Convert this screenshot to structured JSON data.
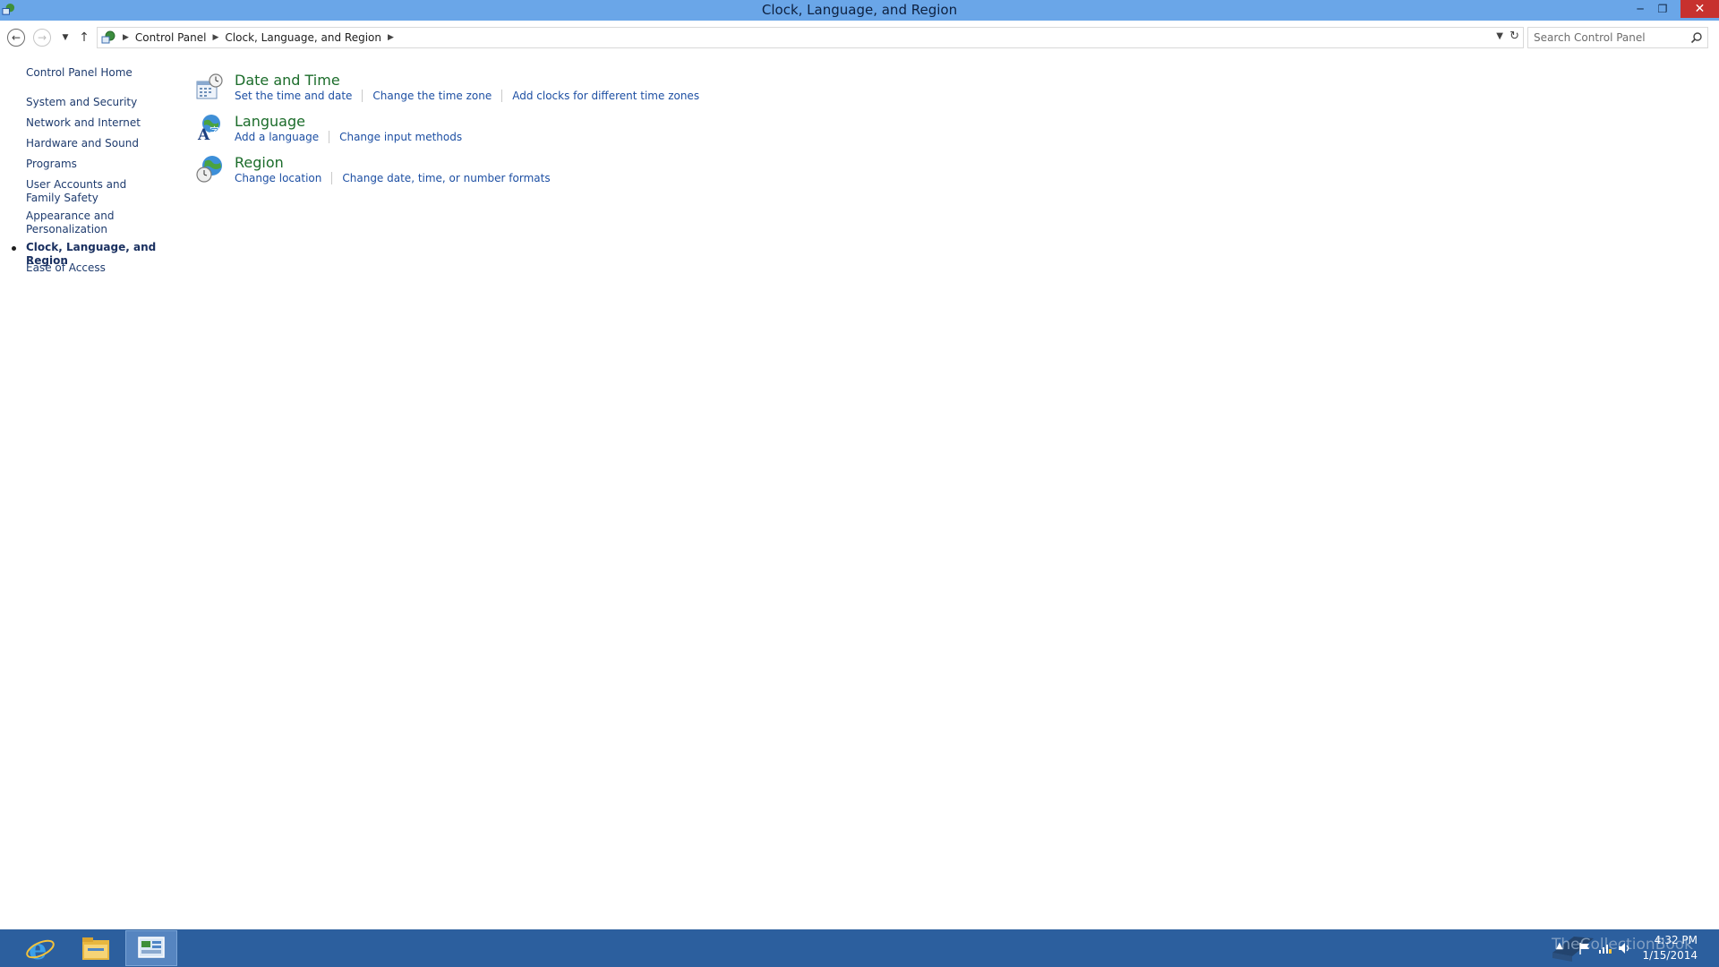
{
  "window": {
    "title": "Clock, Language, and Region",
    "controls": {
      "minimize": "─",
      "maximize": "❐",
      "close": "✕"
    }
  },
  "navbar": {
    "breadcrumbs": [
      "Control Panel",
      "Clock, Language, and Region"
    ],
    "search_placeholder": "Search Control Panel"
  },
  "sidebar": {
    "items": [
      {
        "label": "Control Panel Home"
      },
      {
        "label": "System and Security"
      },
      {
        "label": "Network and Internet"
      },
      {
        "label": "Hardware and Sound"
      },
      {
        "label": "Programs"
      },
      {
        "label": "User Accounts and Family Safety"
      },
      {
        "label": "Appearance and Personalization"
      },
      {
        "label": "Clock, Language, and Region",
        "current": true
      },
      {
        "label": "Ease of Access"
      }
    ]
  },
  "categories": [
    {
      "title": "Date and Time",
      "icon": "date-time-icon",
      "tasks": [
        "Set the time and date",
        "Change the time zone",
        "Add clocks for different time zones"
      ]
    },
    {
      "title": "Language",
      "icon": "language-icon",
      "tasks": [
        "Add a language",
        "Change input methods"
      ]
    },
    {
      "title": "Region",
      "icon": "region-icon",
      "tasks": [
        "Change location",
        "Change date, time, or number formats"
      ]
    }
  ],
  "taskbar": {
    "pinned": [
      "internet-explorer-icon",
      "file-explorer-icon",
      "control-panel-icon"
    ],
    "clock_time": "4:32 PM",
    "clock_date": "1/15/2014",
    "watermark_text": "TheCollectionBook"
  },
  "colors": {
    "titlebar": "#6aa6e8",
    "taskbar": "#2c5f9e",
    "category_title": "#1b6c2a",
    "task_link": "#1d4fa3",
    "close_button": "#c7312e"
  }
}
